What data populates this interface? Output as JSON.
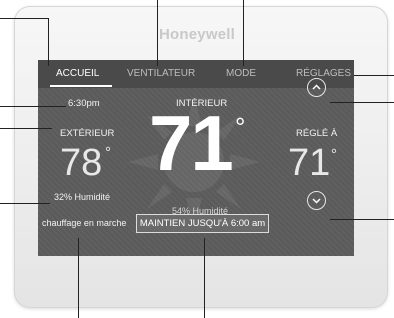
{
  "brand": "Honeywell",
  "tabs": [
    {
      "label": "ACCUEIL",
      "active": true
    },
    {
      "label": "VENTILATEUR",
      "active": false
    },
    {
      "label": "MODE",
      "active": false
    },
    {
      "label": "RÉGLAGES",
      "active": false
    }
  ],
  "time": "6:30pm",
  "indoor": {
    "label": "INTÉRIEUR",
    "temperature": "71",
    "degree": "°",
    "humidity": "54% Humidité"
  },
  "outdoor": {
    "label": "EXTÉRIEUR",
    "temperature": "78",
    "degree": "°",
    "humidity": "32% Humidité"
  },
  "setpoint": {
    "label": "RÉGLÉ À",
    "temperature": "71",
    "degree": "°"
  },
  "system_status": "chauffage en marche",
  "hold_button": "MAINTIEN JUSQU'À 6:00 am",
  "colors": {
    "screen": "#5c5c5c",
    "text": "#ffffff",
    "bezel": "#efefef"
  },
  "icons": [
    "chevron-up-icon",
    "chevron-down-icon",
    "sun-icon"
  ]
}
